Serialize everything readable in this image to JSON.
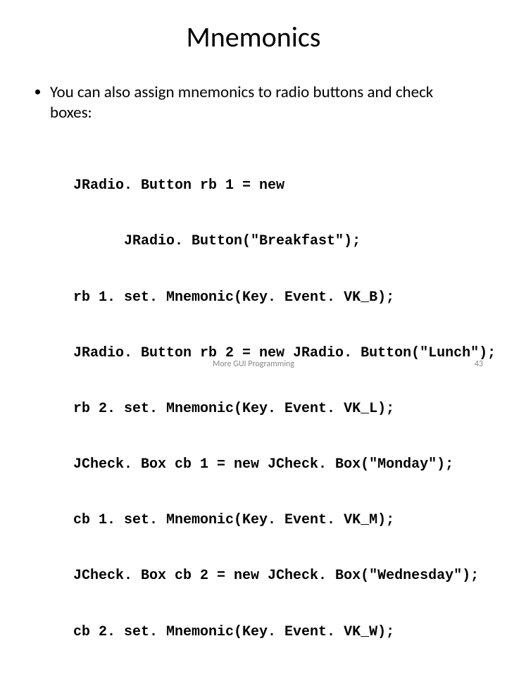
{
  "title": "Mnemonics",
  "bullet_text": "You can also assign mnemonics to radio buttons and check boxes:",
  "code": {
    "l1": "JRadio. Button rb 1 = new",
    "l2": "      JRadio. Button(\"Breakfast\");",
    "l3": "rb 1. set. Mnemonic(Key. Event. VK_B);",
    "l4": "JRadio. Button rb 2 = new JRadio. Button(\"Lunch\");",
    "l5": "rb 2. set. Mnemonic(Key. Event. VK_L);",
    "l6": "JCheck. Box cb 1 = new JCheck. Box(\"Monday\");",
    "l7": "cb 1. set. Mnemonic(Key. Event. VK_M);",
    "l8": "JCheck. Box cb 2 = new JCheck. Box(\"Wednesday\");",
    "l9": "cb 2. set. Mnemonic(Key. Event. VK_W);"
  },
  "footer_center": "More GUI Programming",
  "footer_right": "43"
}
